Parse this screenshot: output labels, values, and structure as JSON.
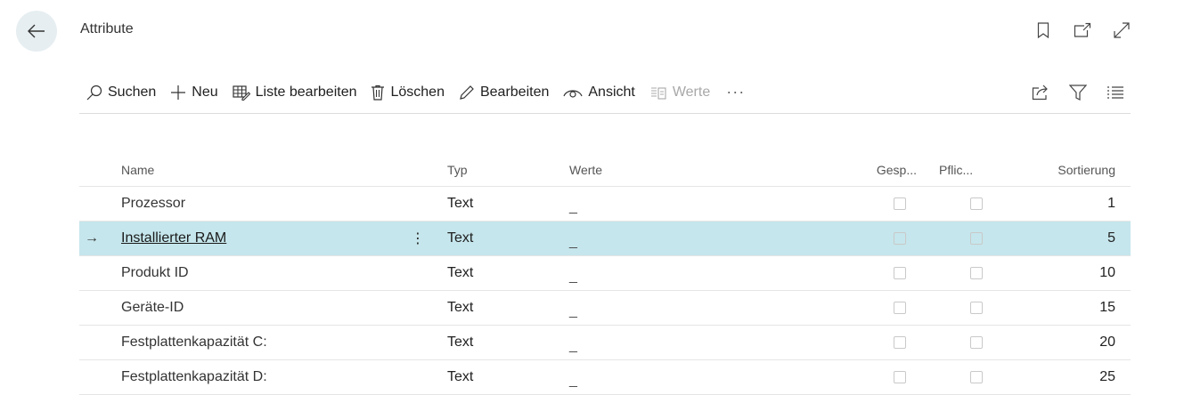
{
  "page": {
    "title": "Attribute"
  },
  "toolbar": {
    "search": "Suchen",
    "new": "Neu",
    "edit_list": "Liste bearbeiten",
    "delete": "Löschen",
    "edit": "Bearbeiten",
    "view": "Ansicht",
    "values": "Werte",
    "more": "···"
  },
  "columns": {
    "name": "Name",
    "typ": "Typ",
    "werte": "Werte",
    "gesp": "Gesp...",
    "pflic": "Pflic...",
    "sortierung": "Sortierung"
  },
  "rows": [
    {
      "name": "Prozessor",
      "typ": "Text",
      "werte": "_",
      "sort": "1",
      "selected": false
    },
    {
      "name": "Installierter RAM",
      "typ": "Text",
      "werte": "_",
      "sort": "5",
      "selected": true
    },
    {
      "name": "Produkt ID",
      "typ": "Text",
      "werte": "_",
      "sort": "10",
      "selected": false
    },
    {
      "name": "Geräte-ID",
      "typ": "Text",
      "werte": "_",
      "sort": "15",
      "selected": false
    },
    {
      "name": "Festplattenkapazität C:",
      "typ": "Text",
      "werte": "_",
      "sort": "20",
      "selected": false
    },
    {
      "name": "Festplattenkapazität D:",
      "typ": "Text",
      "werte": "_",
      "sort": "25",
      "selected": false
    }
  ],
  "selected_row_marker": "→",
  "row_menu": "⋮",
  "colors": {
    "accent": "#0b6a7a",
    "selected_row": "#c5e6ec",
    "back_button_bg": "#e6eef1"
  }
}
